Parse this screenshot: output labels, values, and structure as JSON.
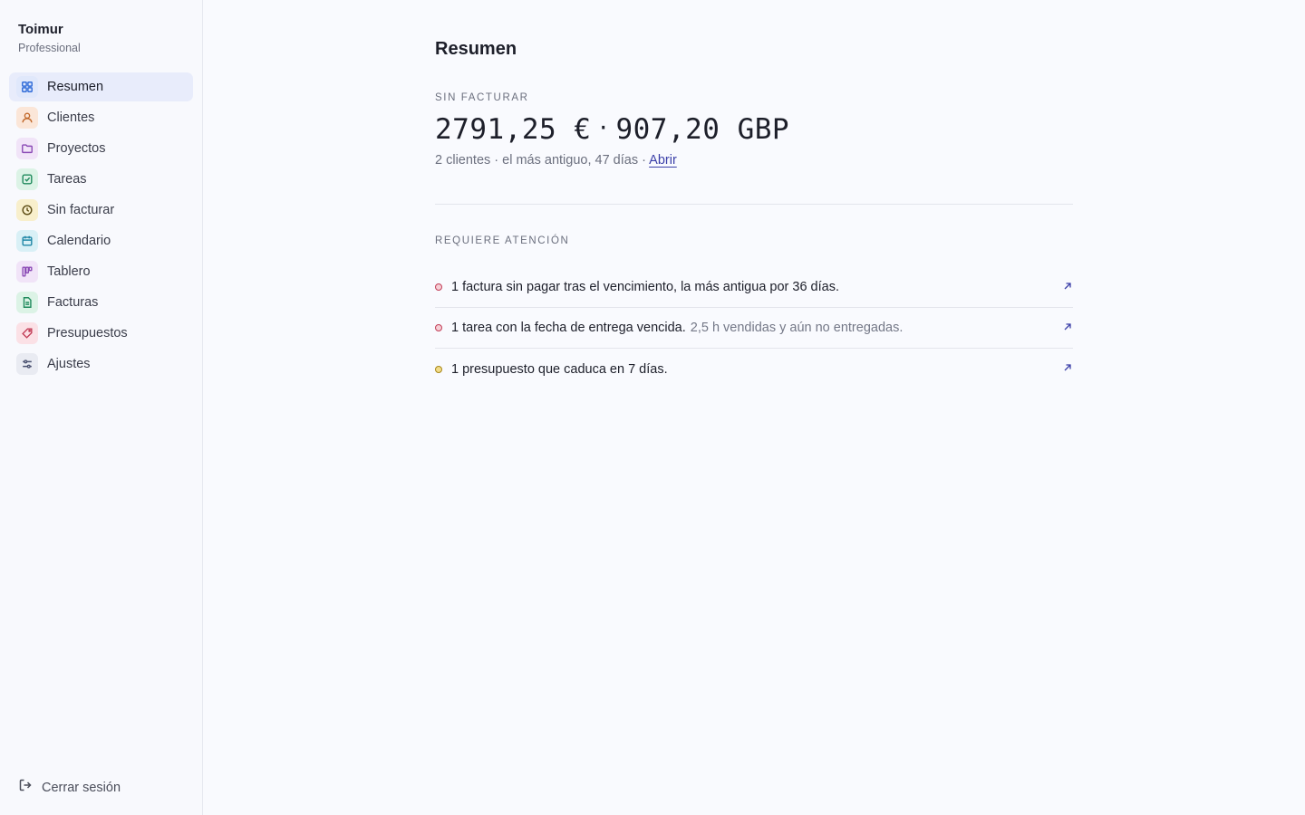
{
  "sidebar": {
    "brand_name": "Toimur",
    "brand_plan": "Professional",
    "items": [
      {
        "label": "Resumen",
        "icon": "grid-icon",
        "active": true,
        "color": "#2f6bd8"
      },
      {
        "label": "Clientes",
        "icon": "user-icon",
        "color": "#c1682b"
      },
      {
        "label": "Proyectos",
        "icon": "folder-icon",
        "color": "#8a4ab5"
      },
      {
        "label": "Tareas",
        "icon": "check-square-icon",
        "color": "#1f8a5c"
      },
      {
        "label": "Sin facturar",
        "icon": "clock-icon",
        "color": "#9a7a16"
      },
      {
        "label": "Calendario",
        "icon": "calendar-icon",
        "color": "#1f86a6"
      },
      {
        "label": "Tablero",
        "icon": "kanban-icon",
        "color": "#8a4ab5"
      },
      {
        "label": "Facturas",
        "icon": "document-icon",
        "color": "#1f8a5c"
      },
      {
        "label": "Presupuestos",
        "icon": "tag-icon",
        "color": "#c23d57"
      },
      {
        "label": "Ajustes",
        "icon": "sliders-icon",
        "color": "#4a5170"
      }
    ],
    "logout_label": "Cerrar sesión"
  },
  "main": {
    "title": "Resumen",
    "unbilled": {
      "label": "SIN FACTURAR",
      "amount_eur": "2791,25 €",
      "separator": "·",
      "amount_gbp": "907,20 GBP",
      "summary": "2 clientes · el más antiguo, 47 días · ",
      "open_link": "Abrir"
    },
    "attention": {
      "label": "REQUIERE ATENCIÓN",
      "items": [
        {
          "text": "1 factura sin pagar tras el vencimiento, la más antigua por 36 días.",
          "muted": "",
          "status": "red"
        },
        {
          "text": "1 tarea con la fecha de entrega vencida.",
          "muted": "2,5 h vendidas y aún no entregadas.",
          "status": "red"
        },
        {
          "text": "1 presupuesto que caduca en 7 días.",
          "muted": "",
          "status": "amber"
        }
      ]
    }
  }
}
